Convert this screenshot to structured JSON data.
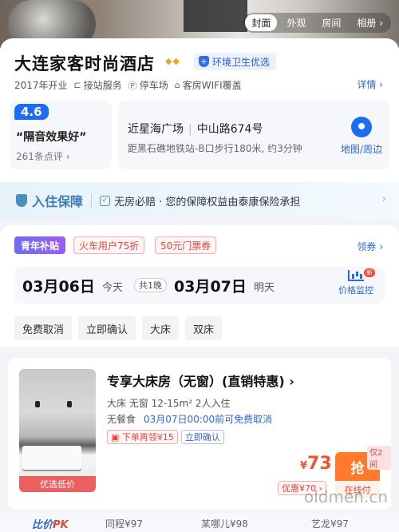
{
  "photo_tabs": [
    "封面",
    "外观",
    "房间",
    "相册 ›"
  ],
  "hotel": {
    "name": "大连家客时尚酒店",
    "diamonds": "◆◆",
    "eco_badge": "环境卫生优选",
    "opened": "2017年开业",
    "facilities": [
      "接站服务",
      "停车场",
      "客房WIFI覆盖"
    ],
    "details_link": "详情 ›"
  },
  "rating": {
    "score": "4.6",
    "quote": "“隔音效果好”",
    "reviews": "261条点评 ›"
  },
  "location": {
    "landmark": "近星海广场",
    "address": "中山路674号",
    "distance": "距黑石礁地铁站-B口步行180米, 约3分钟",
    "map_label": "地图/周边"
  },
  "guarantee": {
    "title": "入住保障",
    "text": "无房必赔 · 您的保障权益由泰康保险承担"
  },
  "promotions": {
    "youth": "青年补贴",
    "items": [
      "火车用户75折",
      "50元门票券"
    ],
    "coupon_link": "领券 ›"
  },
  "dates": {
    "checkin": "03月06日",
    "checkin_day": "今天",
    "nights": "共1晚",
    "checkout": "03月07日",
    "checkout_day": "明天",
    "monitor_label": "价格监控",
    "monitor_new": "新"
  },
  "filters": [
    "免费取消",
    "立即确认",
    "大床",
    "双床"
  ],
  "room": {
    "name": "专享大床房（无窗）(直销特惠) ›",
    "spec": "大床  无窗  12-15m²  2人入住",
    "meal": "无餐食",
    "cancel": "03月07日00:00前可免费取消",
    "tag_coupon": "下单再领¥15",
    "tag_confirm": "立即确认",
    "image_count": "7",
    "image_tag": "优选低价",
    "price_currency": "¥",
    "price": "73",
    "discount": "优惠¥70 ›",
    "grab_label": "抢",
    "grab_sub": "在线付",
    "stock": "仅2间"
  },
  "compare": {
    "title": "比价",
    "title_pk": "PK",
    "items": [
      "同程¥97",
      "某哪儿¥98",
      "艺龙¥97"
    ]
  },
  "watermark": "oldmen.cn"
}
